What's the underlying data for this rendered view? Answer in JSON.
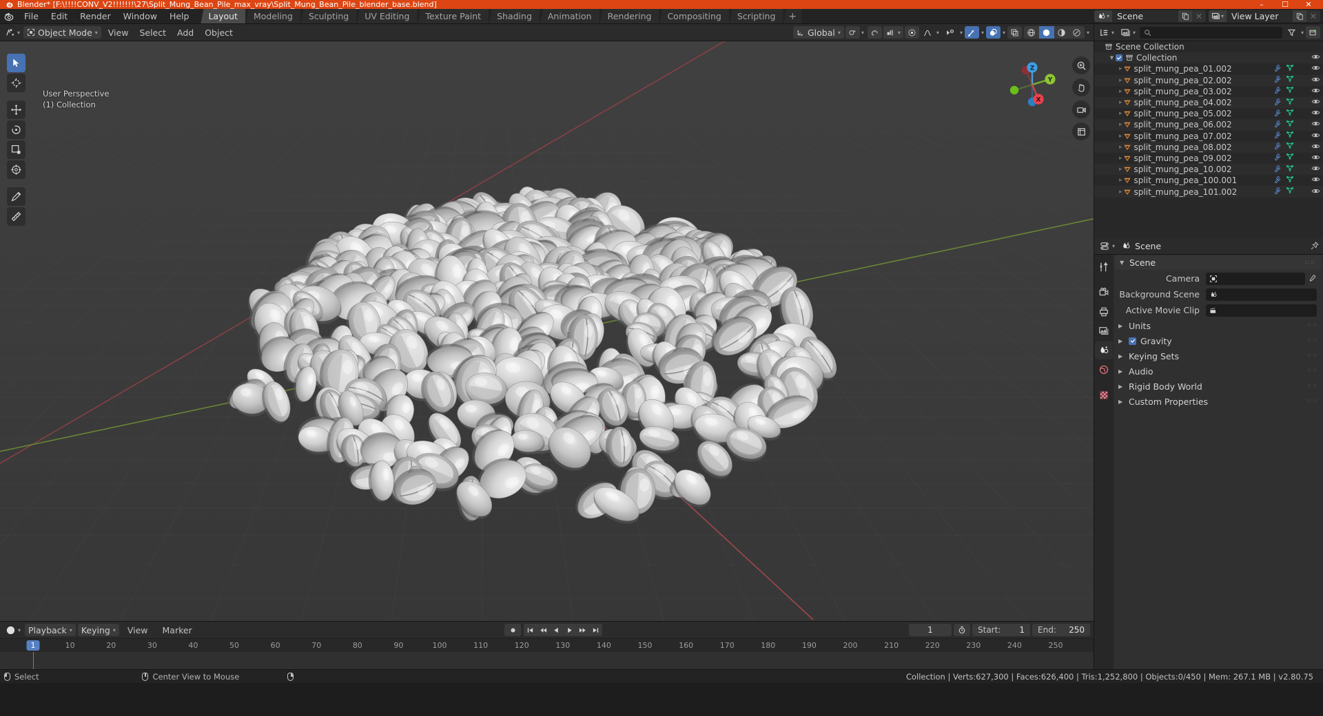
{
  "titlebar": {
    "app": "Blender*",
    "filepath": "[F:\\!!!!CONV_V2!!!!!!!\\27\\Split_Mung_Bean_Pile_max_vray\\Split_Mung_Bean_Pile_blender_base.blend]",
    "full": "Blender* [F:\\!!!!CONV_V2!!!!!!!\\27\\Split_Mung_Bean_Pile_max_vray\\Split_Mung_Bean_Pile_blender_base.blend]",
    "minimize": "–",
    "maximize": "☐",
    "close": "✕",
    "accent": "#dd4512"
  },
  "topbar": {
    "menus": [
      "File",
      "Edit",
      "Render",
      "Window",
      "Help"
    ],
    "workspaces": [
      {
        "label": "Layout",
        "active": true
      },
      {
        "label": "Modeling",
        "active": false
      },
      {
        "label": "Sculpting",
        "active": false
      },
      {
        "label": "UV Editing",
        "active": false
      },
      {
        "label": "Texture Paint",
        "active": false
      },
      {
        "label": "Shading",
        "active": false
      },
      {
        "label": "Animation",
        "active": false
      },
      {
        "label": "Rendering",
        "active": false
      },
      {
        "label": "Compositing",
        "active": false
      },
      {
        "label": "Scripting",
        "active": false
      }
    ],
    "add_workspace": "+",
    "scene_block": {
      "name": "Scene",
      "new_btn": "new-copy",
      "x_btn": "✕"
    },
    "viewlayer_block": {
      "name": "View Layer",
      "new_btn": "new-copy",
      "x_btn": "✕"
    }
  },
  "viewport_header": {
    "mode": "Object Mode",
    "menus": [
      "View",
      "Select",
      "Add",
      "Object"
    ],
    "transform_orientation": "Global",
    "snap_label": "snap-magnet",
    "proportional_label": "proportional-edit"
  },
  "viewport": {
    "overlay_line1": "User Perspective",
    "overlay_line2": "(1) Collection",
    "gizmo_axes": {
      "x": "X",
      "y": "Y",
      "z": "Z"
    },
    "background_top": "#3e3e3e",
    "background_bottom": "#393939",
    "grid_color": "#4d4d4d",
    "axis_x_color": "#c94a4a",
    "axis_y_color": "#7aa832"
  },
  "outliner": {
    "search_placeholder": "",
    "display_mode": "View Layer",
    "rows": [
      {
        "label": "Scene Collection",
        "depth": 0,
        "type": "scene-collection",
        "expand": "",
        "checkbox": false,
        "modifier": false,
        "mesh": false,
        "eye": false
      },
      {
        "label": "Collection",
        "depth": 1,
        "type": "collection",
        "expand": "▼",
        "checkbox": true,
        "modifier": false,
        "mesh": false,
        "eye": true
      },
      {
        "label": "split_mung_pea_01.002",
        "depth": 2,
        "type": "mesh-object",
        "expand": "▶",
        "checkbox": false,
        "modifier": true,
        "mesh": true,
        "eye": true
      },
      {
        "label": "split_mung_pea_02.002",
        "depth": 2,
        "type": "mesh-object",
        "expand": "▶",
        "checkbox": false,
        "modifier": true,
        "mesh": true,
        "eye": true
      },
      {
        "label": "split_mung_pea_03.002",
        "depth": 2,
        "type": "mesh-object",
        "expand": "▶",
        "checkbox": false,
        "modifier": true,
        "mesh": true,
        "eye": true
      },
      {
        "label": "split_mung_pea_04.002",
        "depth": 2,
        "type": "mesh-object",
        "expand": "▶",
        "checkbox": false,
        "modifier": true,
        "mesh": true,
        "eye": true
      },
      {
        "label": "split_mung_pea_05.002",
        "depth": 2,
        "type": "mesh-object",
        "expand": "▶",
        "checkbox": false,
        "modifier": true,
        "mesh": true,
        "eye": true
      },
      {
        "label": "split_mung_pea_06.002",
        "depth": 2,
        "type": "mesh-object",
        "expand": "▶",
        "checkbox": false,
        "modifier": true,
        "mesh": true,
        "eye": true
      },
      {
        "label": "split_mung_pea_07.002",
        "depth": 2,
        "type": "mesh-object",
        "expand": "▶",
        "checkbox": false,
        "modifier": true,
        "mesh": true,
        "eye": true
      },
      {
        "label": "split_mung_pea_08.002",
        "depth": 2,
        "type": "mesh-object",
        "expand": "▶",
        "checkbox": false,
        "modifier": true,
        "mesh": true,
        "eye": true
      },
      {
        "label": "split_mung_pea_09.002",
        "depth": 2,
        "type": "mesh-object",
        "expand": "▶",
        "checkbox": false,
        "modifier": true,
        "mesh": true,
        "eye": true
      },
      {
        "label": "split_mung_pea_10.002",
        "depth": 2,
        "type": "mesh-object",
        "expand": "▶",
        "checkbox": false,
        "modifier": true,
        "mesh": true,
        "eye": true
      },
      {
        "label": "split_mung_pea_100.001",
        "depth": 2,
        "type": "mesh-object",
        "expand": "▶",
        "checkbox": false,
        "modifier": true,
        "mesh": true,
        "eye": true
      },
      {
        "label": "split_mung_pea_101.002",
        "depth": 2,
        "type": "mesh-object",
        "expand": "▶",
        "checkbox": false,
        "modifier": true,
        "mesh": true,
        "eye": true
      }
    ]
  },
  "properties": {
    "breadcrumb": "Scene",
    "panel_title": "Scene",
    "rows": [
      {
        "label": "Camera",
        "value": "",
        "icon": "camera-icon",
        "eyedropper": true
      },
      {
        "label": "Background Scene",
        "value": "",
        "icon": "scene-icon",
        "eyedropper": false
      },
      {
        "label": "Active Movie Clip",
        "value": "",
        "icon": "clip-icon",
        "eyedropper": false
      }
    ],
    "sections": [
      {
        "label": "Units",
        "checkbox": false
      },
      {
        "label": "Gravity",
        "checkbox": true
      },
      {
        "label": "Keying Sets",
        "checkbox": false
      },
      {
        "label": "Audio",
        "checkbox": false
      },
      {
        "label": "Rigid Body World",
        "checkbox": false
      },
      {
        "label": "Custom Properties",
        "checkbox": false
      }
    ],
    "tabs": [
      "tool-icon",
      "render-icon",
      "output-icon",
      "viewlayer-icon",
      "scene-icon",
      "world-icon",
      "texture-icon"
    ]
  },
  "timeline": {
    "menus": [
      "Playback",
      "Keying",
      "View",
      "Marker"
    ],
    "current_frame": "1",
    "start_label": "Start:",
    "start_value": "1",
    "end_label": "End:",
    "end_value": "250",
    "ticks": [
      "10",
      "20",
      "30",
      "40",
      "50",
      "60",
      "70",
      "80",
      "90",
      "100",
      "110",
      "120",
      "130",
      "140",
      "150",
      "160",
      "170",
      "180",
      "190",
      "200",
      "210",
      "220",
      "230",
      "240",
      "250"
    ],
    "playhead_label": "1"
  },
  "statusbar": {
    "left_items": [
      {
        "mouse": "left",
        "label": "Select"
      },
      {
        "mouse": "middle",
        "label": "Center View to Mouse"
      },
      {
        "mouse": "right",
        "label": ""
      }
    ],
    "stats": "Collection | Verts:627,300 | Faces:626,400 | Tris:1,252,800 | Objects:0/450 | Mem: 267.1 MB | v2.80.75"
  }
}
